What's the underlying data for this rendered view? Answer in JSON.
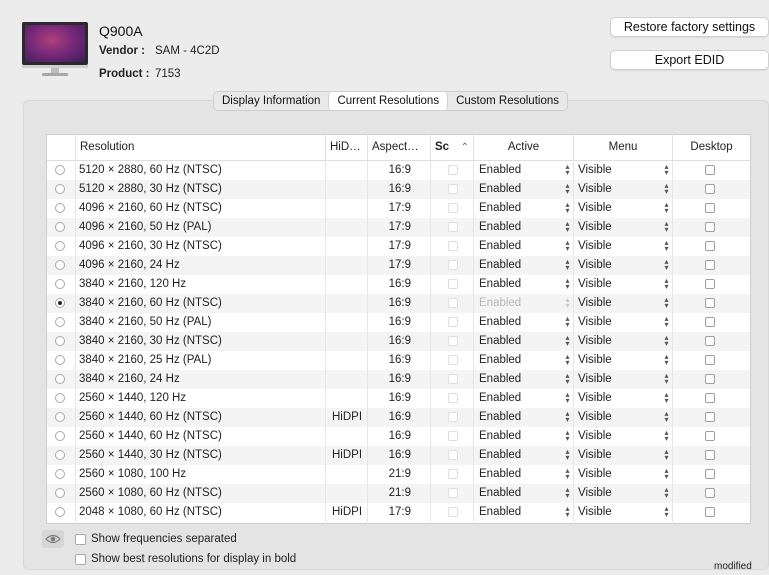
{
  "display": {
    "name": "Q900A",
    "vendor_label": "Vendor :",
    "vendor_value": "SAM - 4C2D",
    "product_label": "Product :",
    "product_value": "7153"
  },
  "buttons": {
    "restore": "Restore factory settings",
    "export": "Export EDID"
  },
  "tabs": [
    {
      "label": "Display Information",
      "active": false
    },
    {
      "label": "Current Resolutions",
      "active": true
    },
    {
      "label": "Custom Resolutions",
      "active": false
    }
  ],
  "table": {
    "headers": {
      "resolution": "Resolution",
      "hidpi": "HiD…",
      "aspect": "Aspect…",
      "sc": "Sc",
      "active": "Active",
      "menu": "Menu",
      "desktop": "Desktop"
    },
    "rows": [
      {
        "res": "5120 × 2880, 60 Hz (NTSC)",
        "hidpi": "",
        "aspect": "16:9",
        "active": "Enabled",
        "menu": "Visible",
        "selected": false
      },
      {
        "res": "5120 × 2880, 30 Hz (NTSC)",
        "hidpi": "",
        "aspect": "16:9",
        "active": "Enabled",
        "menu": "Visible",
        "selected": false
      },
      {
        "res": "4096 × 2160, 60 Hz (NTSC)",
        "hidpi": "",
        "aspect": "17:9",
        "active": "Enabled",
        "menu": "Visible",
        "selected": false
      },
      {
        "res": "4096 × 2160, 50 Hz (PAL)",
        "hidpi": "",
        "aspect": "17:9",
        "active": "Enabled",
        "menu": "Visible",
        "selected": false
      },
      {
        "res": "4096 × 2160, 30 Hz (NTSC)",
        "hidpi": "",
        "aspect": "17:9",
        "active": "Enabled",
        "menu": "Visible",
        "selected": false
      },
      {
        "res": "4096 × 2160, 24 Hz",
        "hidpi": "",
        "aspect": "17:9",
        "active": "Enabled",
        "menu": "Visible",
        "selected": false
      },
      {
        "res": "3840 × 2160, 120 Hz",
        "hidpi": "",
        "aspect": "16:9",
        "active": "Enabled",
        "menu": "Visible",
        "selected": false
      },
      {
        "res": "3840 × 2160, 60 Hz (NTSC)",
        "hidpi": "",
        "aspect": "16:9",
        "active": "Enabled",
        "menu": "Visible",
        "selected": true
      },
      {
        "res": "3840 × 2160, 50 Hz (PAL)",
        "hidpi": "",
        "aspect": "16:9",
        "active": "Enabled",
        "menu": "Visible",
        "selected": false
      },
      {
        "res": "3840 × 2160, 30 Hz (NTSC)",
        "hidpi": "",
        "aspect": "16:9",
        "active": "Enabled",
        "menu": "Visible",
        "selected": false
      },
      {
        "res": "3840 × 2160, 25 Hz (PAL)",
        "hidpi": "",
        "aspect": "16:9",
        "active": "Enabled",
        "menu": "Visible",
        "selected": false
      },
      {
        "res": "3840 × 2160, 24 Hz",
        "hidpi": "",
        "aspect": "16:9",
        "active": "Enabled",
        "menu": "Visible",
        "selected": false
      },
      {
        "res": "2560 × 1440, 120 Hz",
        "hidpi": "",
        "aspect": "16:9",
        "active": "Enabled",
        "menu": "Visible",
        "selected": false
      },
      {
        "res": "2560 × 1440, 60 Hz (NTSC)",
        "hidpi": "HiDPI",
        "aspect": "16:9",
        "active": "Enabled",
        "menu": "Visible",
        "selected": false
      },
      {
        "res": "2560 × 1440, 60 Hz (NTSC)",
        "hidpi": "",
        "aspect": "16:9",
        "active": "Enabled",
        "menu": "Visible",
        "selected": false
      },
      {
        "res": "2560 × 1440, 30 Hz (NTSC)",
        "hidpi": "HiDPI",
        "aspect": "16:9",
        "active": "Enabled",
        "menu": "Visible",
        "selected": false
      },
      {
        "res": "2560 × 1080, 100 Hz",
        "hidpi": "",
        "aspect": "21:9",
        "active": "Enabled",
        "menu": "Visible",
        "selected": false
      },
      {
        "res": "2560 × 1080, 60 Hz (NTSC)",
        "hidpi": "",
        "aspect": "21:9",
        "active": "Enabled",
        "menu": "Visible",
        "selected": false
      },
      {
        "res": "2048 × 1080, 60 Hz (NTSC)",
        "hidpi": "HiDPI",
        "aspect": "17:9",
        "active": "Enabled",
        "menu": "Visible",
        "selected": false
      }
    ]
  },
  "options": {
    "show_frequencies": "Show frequencies separated",
    "show_best": "Show best resolutions for display in bold"
  },
  "status": "modified"
}
